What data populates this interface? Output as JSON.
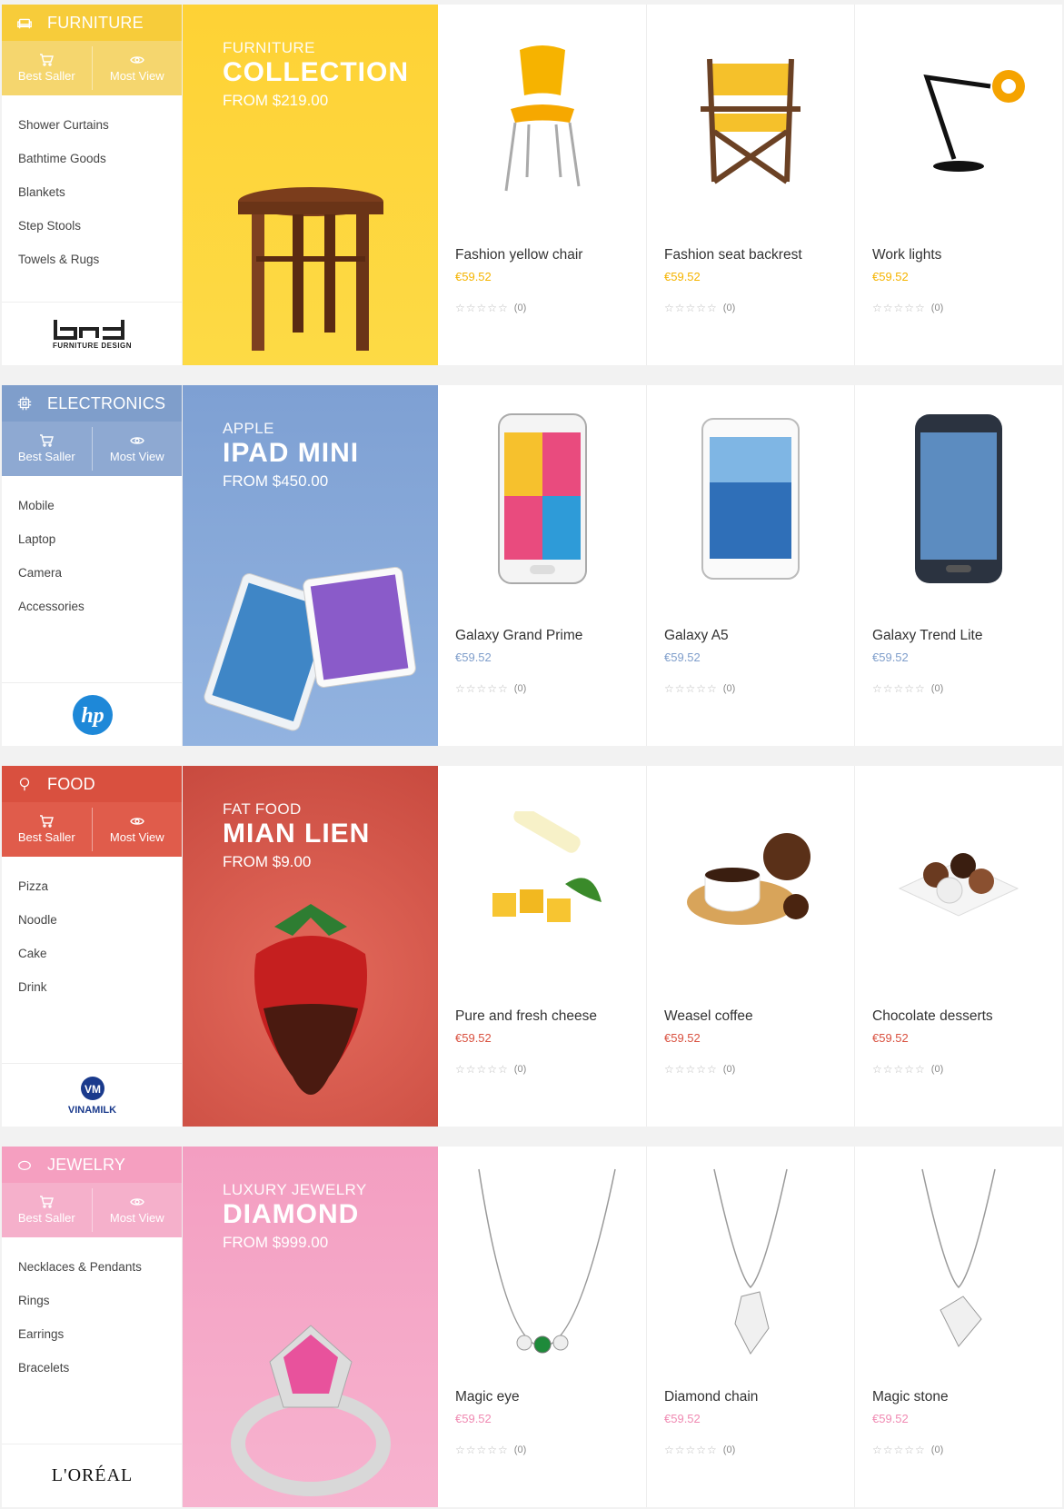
{
  "tabs": {
    "best_seller": "Best Saller",
    "most_view": "Most View"
  },
  "sections": [
    {
      "key": "furniture",
      "title": "FURNITURE",
      "icon": "sofa-icon",
      "head_color": "#f7cc3a",
      "tabs_color": "#f5d66e",
      "banner_color": "#fed235",
      "price_color": "#f5b400",
      "subcategories": [
        "Shower Curtains",
        "Bathtime Goods",
        "Blankets",
        "Step Stools",
        "Towels & Rugs"
      ],
      "brand": {
        "logo": "bnd",
        "caption": "FURNITURE DESIGN"
      },
      "banner": {
        "kicker": "FURNITURE",
        "title": "COLLECTION",
        "price": "FROM $219.00"
      },
      "products": [
        {
          "name": "Fashion yellow chair",
          "price": "€59.52",
          "reviews": "(0)"
        },
        {
          "name": "Fashion seat backrest",
          "price": "€59.52",
          "reviews": "(0)"
        },
        {
          "name": "Work lights",
          "price": "€59.52",
          "reviews": "(0)"
        }
      ]
    },
    {
      "key": "electronics",
      "title": "ELECTRONICS",
      "icon": "chip-icon",
      "head_color": "#7f9ecb",
      "tabs_color": "#8ea9d2",
      "banner_color": "#86a7d6",
      "price_color": "#7f9ecb",
      "subcategories": [
        "Mobile",
        "Laptop",
        "Camera",
        "Accessories"
      ],
      "brand": {
        "logo": "hp",
        "caption": ""
      },
      "banner": {
        "kicker": "APPLE",
        "title": "IPAD MINI",
        "price": "FROM $450.00"
      },
      "products": [
        {
          "name": "Galaxy Grand Prime",
          "price": "€59.52",
          "reviews": "(0)"
        },
        {
          "name": "Galaxy A5",
          "price": "€59.52",
          "reviews": "(0)"
        },
        {
          "name": "Galaxy Trend Lite",
          "price": "€59.52",
          "reviews": "(0)"
        }
      ]
    },
    {
      "key": "food",
      "title": "FOOD",
      "icon": "pin-icon",
      "head_color": "#d9503f",
      "tabs_color": "#e05c4b",
      "banner_color": "#d4564a",
      "price_color": "#d9503f",
      "subcategories": [
        "Pizza",
        "Noodle",
        "Cake",
        "Drink"
      ],
      "brand": {
        "logo": "vinamilk",
        "caption": "VINAMILK"
      },
      "banner": {
        "kicker": "FAT FOOD",
        "title": "MIAN LIEN",
        "price": "FROM $9.00"
      },
      "products": [
        {
          "name": "Pure and fresh cheese",
          "price": "€59.52",
          "reviews": "(0)"
        },
        {
          "name": "Weasel coffee",
          "price": "€59.52",
          "reviews": "(0)"
        },
        {
          "name": "Chocolate desserts",
          "price": "€59.52",
          "reviews": "(0)"
        }
      ]
    },
    {
      "key": "jewelry",
      "title": "JEWELRY",
      "icon": "ring-icon",
      "head_color": "#f59fc0",
      "tabs_color": "#f5b0cb",
      "banner_color": "#f4a3c4",
      "price_color": "#f08bb3",
      "subcategories": [
        "Necklaces & Pendants",
        "Rings",
        "Earrings",
        "Bracelets"
      ],
      "brand": {
        "logo": "loreal",
        "caption": "L'ORÉAL"
      },
      "banner": {
        "kicker": "LUXURY JEWELRY",
        "title": "DIAMOND",
        "price": "FROM $999.00"
      },
      "products": [
        {
          "name": "Magic eye",
          "price": "€59.52",
          "reviews": "(0)"
        },
        {
          "name": "Diamond chain",
          "price": "€59.52",
          "reviews": "(0)"
        },
        {
          "name": "Magic stone",
          "price": "€59.52",
          "reviews": "(0)"
        }
      ]
    }
  ]
}
